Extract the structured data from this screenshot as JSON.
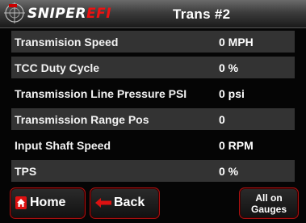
{
  "header": {
    "brand_prefix": "SNIPER",
    "brand_suffix": "EFI",
    "title": "Trans #2"
  },
  "rows": [
    {
      "label": "Transmision Speed",
      "value": "0 MPH"
    },
    {
      "label": "TCC Duty Cycle",
      "value": "0 %"
    },
    {
      "label": "Transmission Line Pressure PSI",
      "value": "0 psi"
    },
    {
      "label": "Transmission Range Pos",
      "value": "0"
    },
    {
      "label": "Input Shaft Speed",
      "value": "0 RPM"
    },
    {
      "label": "TPS",
      "value": "0 %"
    }
  ],
  "buttons": {
    "home": "Home",
    "back": "Back",
    "gauges_line1": "All on",
    "gauges_line2": "Gauges"
  },
  "colors": {
    "accent": "#dd1111",
    "row_alt": "#333333",
    "background": "#050505"
  }
}
